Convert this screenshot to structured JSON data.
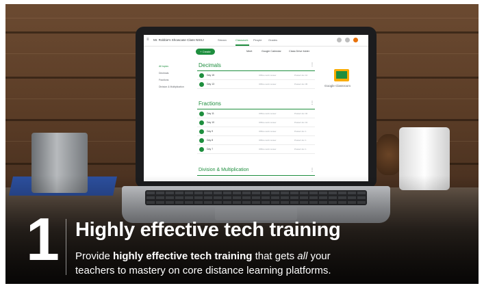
{
  "classroom": {
    "class_title": "Mr. Robbie's Showcase Class NSSJ",
    "tabs": [
      "Stream",
      "Classwork",
      "People",
      "Grades"
    ],
    "create_label": "+ Create",
    "tools": [
      "Meet",
      "Google Calendar",
      "Class Drive folder"
    ],
    "sidebar": [
      "All topics",
      "Decimals",
      "Fractions",
      "Division & Multiplication"
    ],
    "sections": [
      {
        "title": "Decimals",
        "rows": [
          {
            "label": "Day 15",
            "mid": "Offline work review",
            "right": "Posted Jun 10"
          },
          {
            "label": "Day 13",
            "mid": "Offline work review",
            "right": "Posted Jun 05"
          }
        ]
      },
      {
        "title": "Fractions",
        "rows": [
          {
            "label": "Day 11",
            "mid": "Offline work review",
            "right": "Posted Jun 02"
          },
          {
            "label": "Day 10",
            "mid": "Offline work review",
            "right": "Posted Jun 01"
          },
          {
            "label": "Day 9",
            "mid": "Offline work review",
            "right": "Posted Jun 1"
          },
          {
            "label": "Day 8",
            "mid": "Offline work review",
            "right": "Posted Jun 1"
          },
          {
            "label": "Day 7",
            "mid": "Offline work review",
            "right": "Posted Jun 1"
          }
        ]
      },
      {
        "title": "Division & Multiplication",
        "rows": []
      }
    ],
    "brand_label": "Google Classroom",
    "accent": "#1e8e3e"
  },
  "overlay": {
    "number": "1",
    "headline": "Highly effective tech training",
    "sub_before": "Provide ",
    "sub_bold": "highly effective tech training",
    "sub_mid": " that gets ",
    "sub_italic": "all",
    "sub_after": " your teachers to mastery on core distance learning platforms."
  }
}
